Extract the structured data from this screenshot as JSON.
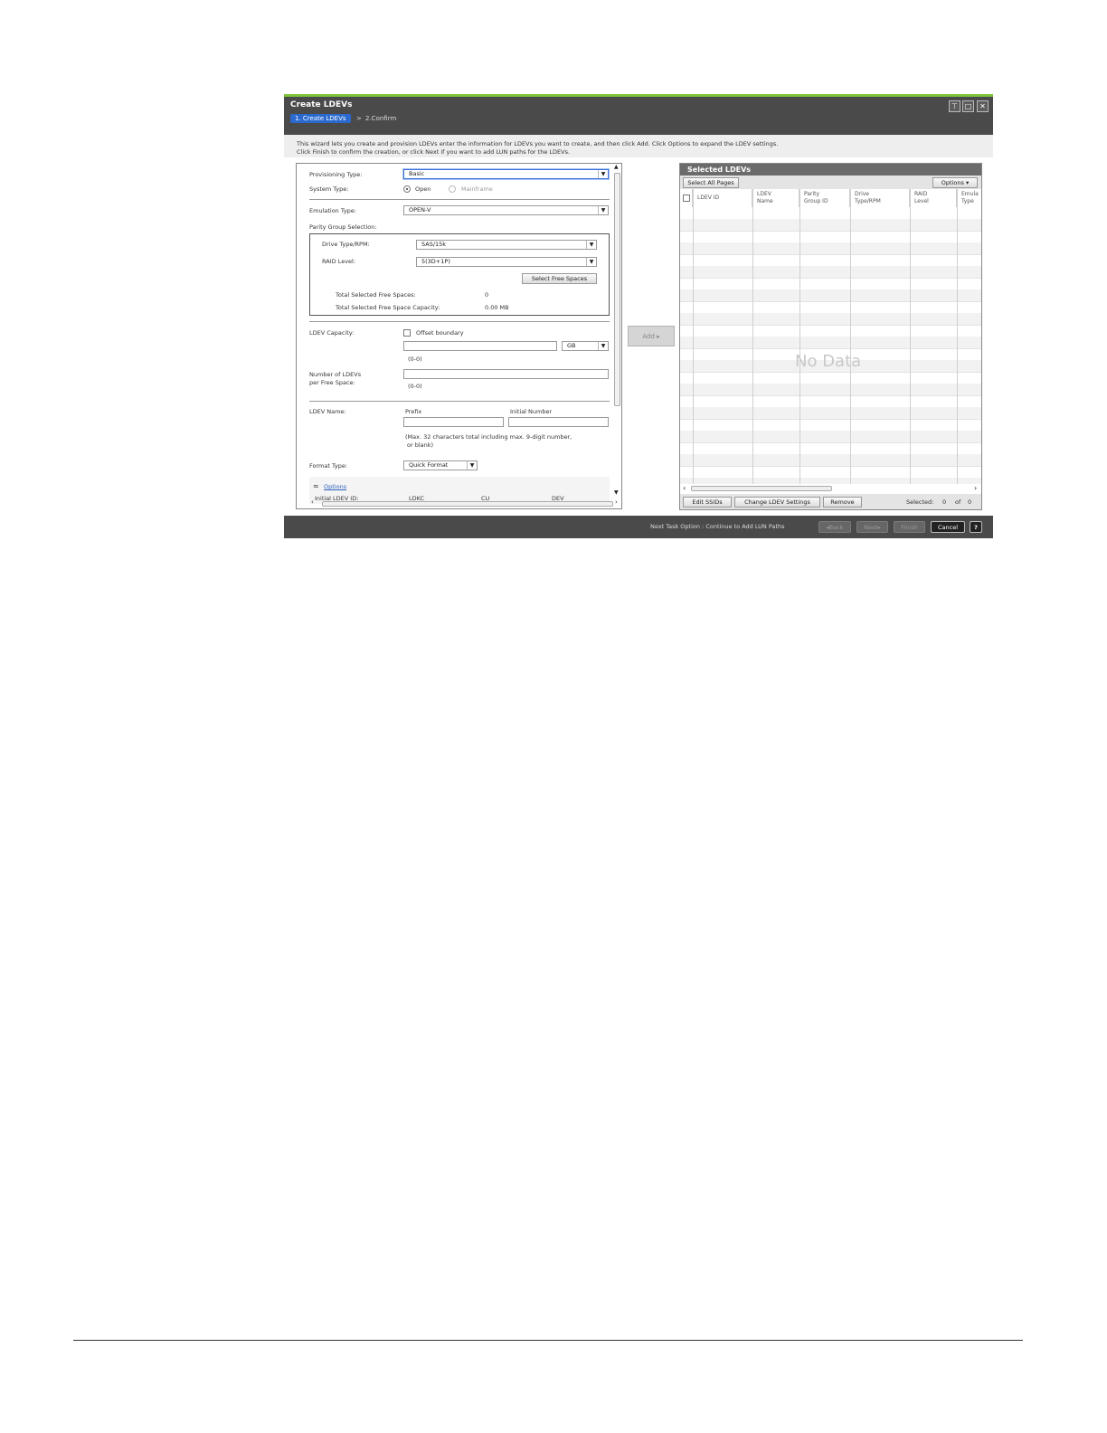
{
  "window": {
    "title": "Create LDEVs",
    "controls": [
      "pin-icon",
      "maximize-icon",
      "close-icon"
    ]
  },
  "steps": {
    "step1": "1. Create LDEVs",
    "separator": ">",
    "step2": "2.Confirm"
  },
  "instructions": {
    "line1": "This wizard lets you create and provision LDEVs enter the information for  LDEVs you want to create, and then click Add. Click Options to expand the LDEV settings.",
    "line2": "Click Finish to confirm the creation, or click Next if you want to add LUN paths for the LDEVs."
  },
  "form": {
    "provisioning_type_label": "Provisioning Type:",
    "provisioning_type_value": "Basic",
    "system_type_label": "System Type:",
    "system_type_open": "Open",
    "system_type_mainframe": "Mainframe",
    "emulation_type_label": "Emulation Type:",
    "emulation_type_value": "OPEN-V",
    "parity_group_label": "Parity Group Selection:",
    "drive_type_label": "Drive Type/RPM:",
    "drive_type_value": "SAS/15k",
    "raid_level_label": "RAID Level:",
    "raid_level_value": "5(3D+1P)",
    "select_free_spaces": "Select Free Spaces",
    "total_free_spaces_label": "Total Selected Free Spaces:",
    "total_free_spaces_value": "0",
    "total_capacity_label": "Total Selected Free Space Capacity:",
    "total_capacity_value": "0.00 MB",
    "ldev_capacity_label": "LDEV Capacity:",
    "offset_boundary_label": "Offset boundary",
    "capacity_value": "",
    "capacity_unit": "GB",
    "capacity_range": "(0-0)",
    "num_ldevs_label_1": "Number of LDEVs",
    "num_ldevs_label_2": "per Free Space:",
    "num_ldevs_value": "",
    "num_ldevs_range": "(0-0)",
    "ldev_name_label": "LDEV Name:",
    "prefix_label": "Prefix",
    "prefix_value": "",
    "initial_number_label": "Initial Number",
    "initial_number_value": "",
    "name_hint_1": "(Max. 32 characters total including max. 9-digit number,",
    "name_hint_2": "or blank)",
    "format_type_label": "Format Type:",
    "format_type_value": "Quick Format",
    "options_link": "Options",
    "initial_ldev_id_label": "Initial LDEV ID:",
    "ldkc_label": "LDKC",
    "cu_label": "CU",
    "dev_label": "DEV"
  },
  "add_button": "Add",
  "selected_panel": {
    "title": "Selected LDEVs",
    "select_all": "Select All Pages",
    "options": "Options",
    "columns": [
      {
        "line1": "LDEV ID",
        "line2": ""
      },
      {
        "line1": "LDEV",
        "line2": "Name"
      },
      {
        "line1": "Parity",
        "line2": "Group ID"
      },
      {
        "line1": "Drive",
        "line2": "Type/RPM"
      },
      {
        "line1": "RAID",
        "line2": "Level"
      },
      {
        "line1": "Emula",
        "line2": "Type"
      }
    ],
    "no_data": "No Data",
    "edit_ssids": "Edit SSIDs",
    "change_settings": "Change LDEV Settings",
    "remove": "Remove",
    "selected_label": "Selected:",
    "selected_count": "0",
    "of_label": "of",
    "total_count": "0"
  },
  "footer": {
    "next_task": "Next Task Option : Continue to Add LUN Paths",
    "back": "Back",
    "next": "Next",
    "finish": "Finish",
    "cancel": "Cancel",
    "help": "?"
  }
}
